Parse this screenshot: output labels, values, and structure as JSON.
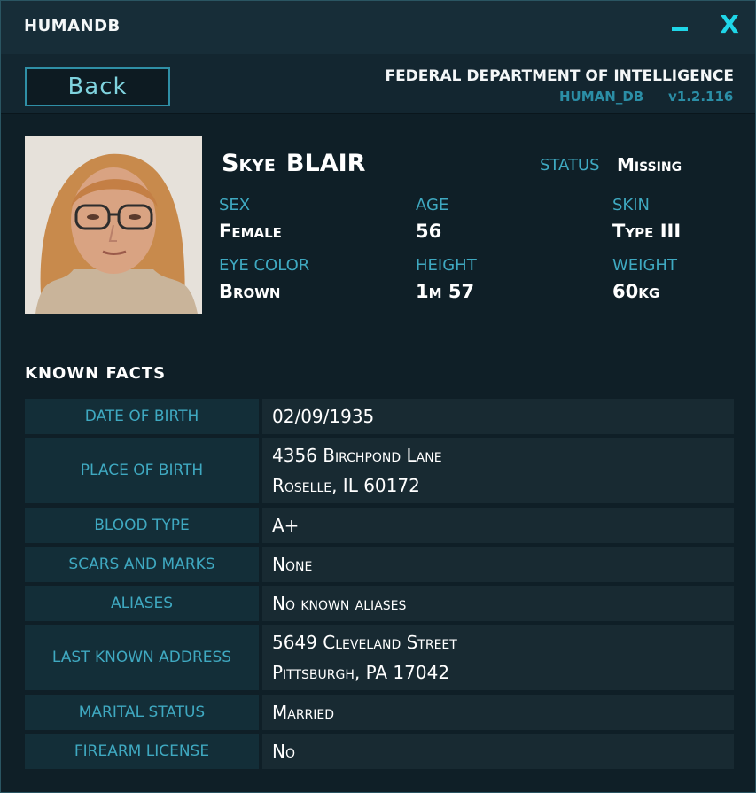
{
  "window": {
    "title": "HUMANDB"
  },
  "header": {
    "back_label": "Back",
    "agency": "FEDERAL DEPARTMENT OF INTELLIGENCE",
    "db_name": "HUMAN_DB",
    "version": "v1.2.116"
  },
  "profile": {
    "first_name": "Skye",
    "last_name": "BLAIR",
    "status_label": "STATUS",
    "status_value": "Missing",
    "attributes": [
      {
        "label": "SEX",
        "value": "Female"
      },
      {
        "label": "AGE",
        "value": "56"
      },
      {
        "label": "SKIN",
        "value": "Type III"
      },
      {
        "label": "EYE COLOR",
        "value": "Brown"
      },
      {
        "label": "HEIGHT",
        "value": "1m 57"
      },
      {
        "label": "WEIGHT",
        "value": "60kg"
      }
    ]
  },
  "facts": {
    "title": "KNOWN FACTS",
    "rows": [
      {
        "label": "DATE OF BIRTH",
        "lines": [
          "02/09/1935"
        ]
      },
      {
        "label": "PLACE OF BIRTH",
        "lines": [
          "4356 Birchpond Lane",
          "Roselle, IL 60172"
        ]
      },
      {
        "label": "BLOOD TYPE",
        "lines": [
          "A+"
        ]
      },
      {
        "label": "SCARS AND MARKS",
        "lines": [
          "None"
        ]
      },
      {
        "label": "ALIASES",
        "lines": [
          "No known aliases"
        ]
      },
      {
        "label": "LAST KNOWN ADDRESS",
        "lines": [
          "5649 Cleveland Street",
          "Pittsburgh, PA 17042"
        ]
      },
      {
        "label": "MARITAL STATUS",
        "lines": [
          "Married"
        ]
      },
      {
        "label": "FIREARM LICENSE",
        "lines": [
          "No"
        ]
      }
    ]
  },
  "colors": {
    "accent": "#1fd6e8",
    "label": "#3fa9c1",
    "background": "#0f1f27"
  }
}
